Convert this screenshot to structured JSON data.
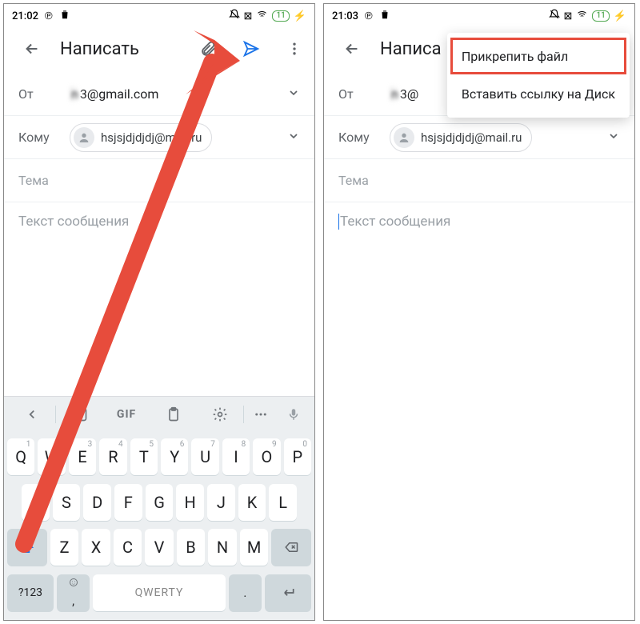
{
  "left": {
    "status": {
      "time": "21:02",
      "battery": "11"
    },
    "toolbar": {
      "title": "Написать"
    },
    "from": {
      "label": "От",
      "value_masked": "n",
      "value_suffix": "3@gmail.com"
    },
    "to": {
      "label": "Кому",
      "chip": "hsjsjdjdjdj@mail.ru"
    },
    "subject": {
      "placeholder": "Тема"
    },
    "body": {
      "placeholder": "Текст сообщения"
    },
    "keyboard": {
      "gif": "GIF",
      "row1": [
        {
          "k": "Q",
          "s": "1"
        },
        {
          "k": "W",
          "s": "2"
        },
        {
          "k": "E",
          "s": "3"
        },
        {
          "k": "R",
          "s": "4"
        },
        {
          "k": "T",
          "s": "5"
        },
        {
          "k": "Y",
          "s": "6"
        },
        {
          "k": "U",
          "s": "7"
        },
        {
          "k": "I",
          "s": "8"
        },
        {
          "k": "O",
          "s": "9"
        },
        {
          "k": "P",
          "s": "0"
        }
      ],
      "row2": [
        "A",
        "S",
        "D",
        "F",
        "G",
        "H",
        "J",
        "K",
        "L"
      ],
      "row3": [
        "Z",
        "X",
        "C",
        "V",
        "B",
        "N",
        "M"
      ],
      "num": "?123",
      "space": "QWERTY"
    }
  },
  "right": {
    "status": {
      "time": "21:03",
      "battery": "11"
    },
    "toolbar": {
      "title": "Написа"
    },
    "from": {
      "label": "От",
      "value_masked": "n",
      "value_suffix": "3@"
    },
    "to": {
      "label": "Кому",
      "chip": "hsjsjdjdjdj@mail.ru"
    },
    "subject": {
      "placeholder": "Тема"
    },
    "body": {
      "placeholder": "Текст сообщения"
    },
    "menu": {
      "attach": "Прикрепить файл",
      "drive": "Вставить ссылку на Диск"
    }
  }
}
